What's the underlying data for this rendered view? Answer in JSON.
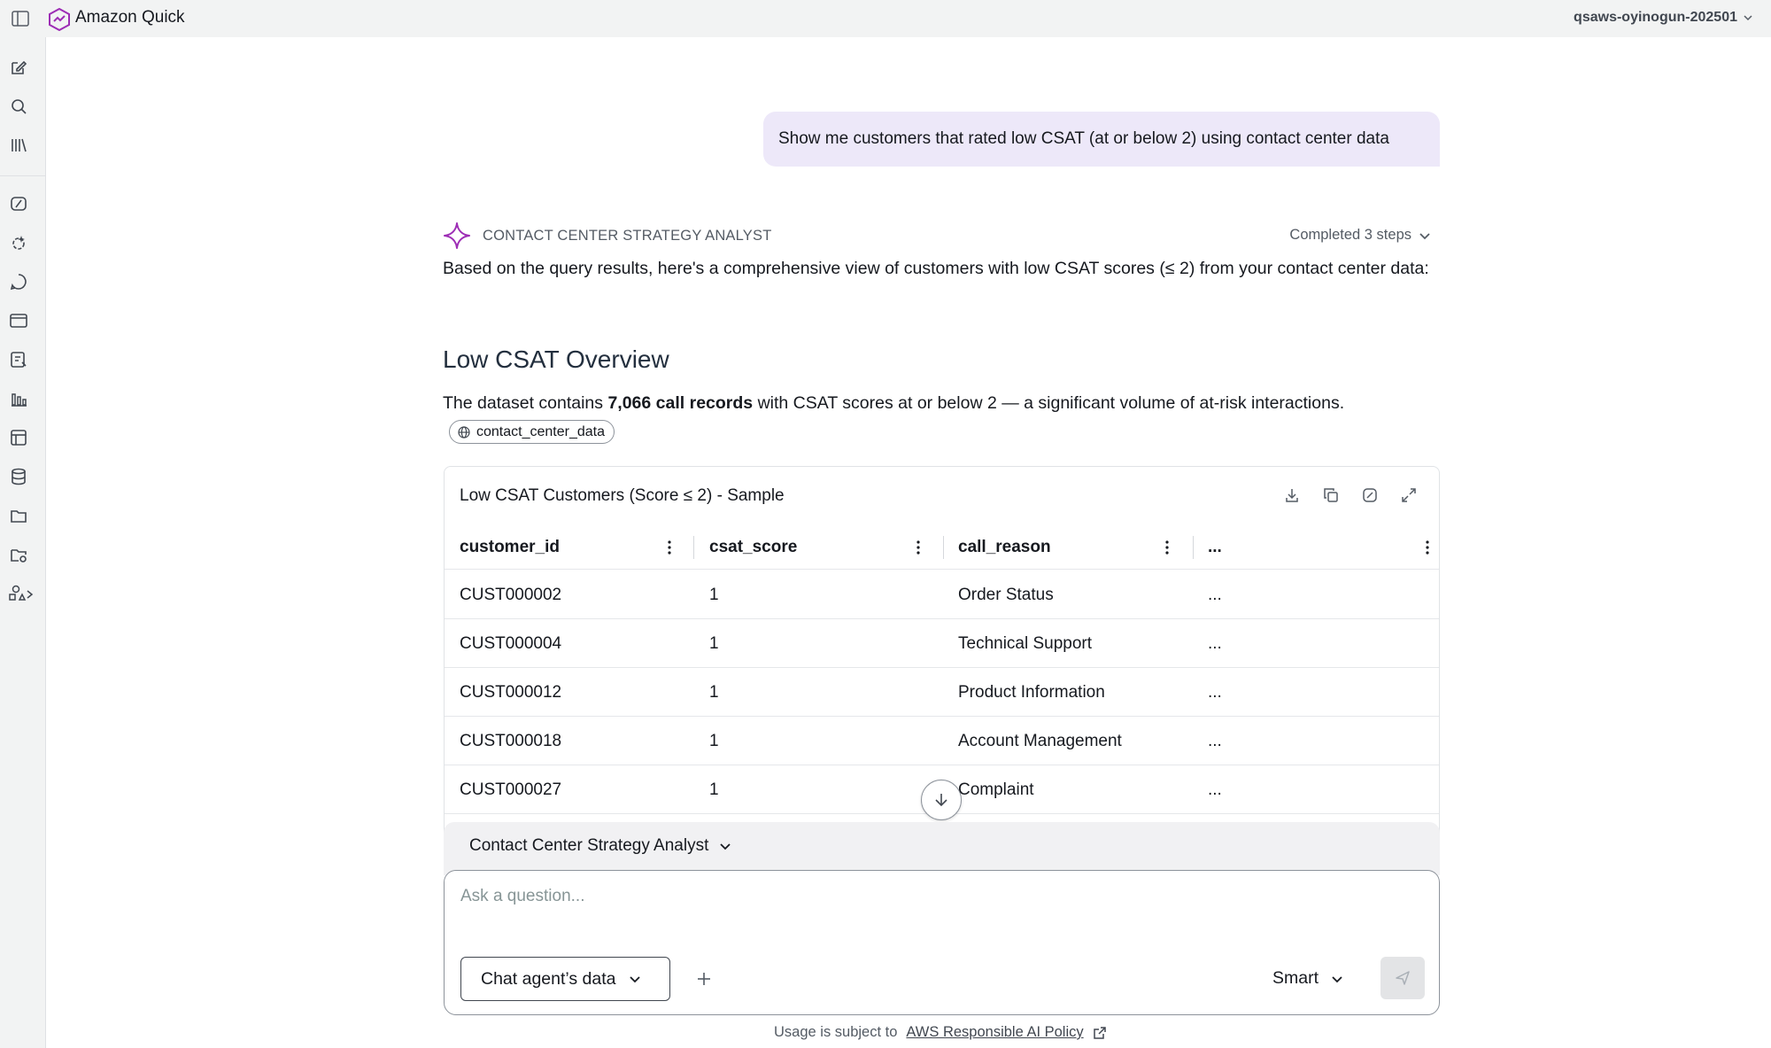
{
  "app": {
    "title": "Amazon Quick",
    "account": "qsaws-oyinogun-202501"
  },
  "rail": {
    "icons": [
      "compose-icon",
      "search-icon",
      "library-icon",
      "agents-icon",
      "research-icon",
      "chat-icon",
      "spaces-icon",
      "flows-icon",
      "dashboards-icon",
      "scenarios-icon",
      "datasets-icon",
      "folders-icon",
      "integrations-icon",
      "extensions-icon"
    ]
  },
  "chat": {
    "user_message": "Show me customers that rated low CSAT (at or below 2) using contact center data",
    "agent_name": "CONTACT CENTER STRATEGY ANALYST",
    "steps_label": "Completed 3 steps",
    "intro": "Based on the query results, here's a comprehensive view of customers with low CSAT scores (≤ 2) from your contact center data:",
    "section_title": "Low CSAT Overview",
    "summary_pre": "The dataset contains ",
    "summary_bold": "7,066 call records",
    "summary_post": " with CSAT scores at or below 2 — a significant volume of at-risk interactions.",
    "source_chip": "contact_center_data"
  },
  "table": {
    "title": "Low CSAT Customers (Score ≤ 2) - Sample",
    "columns": [
      "customer_id",
      "csat_score",
      "call_reason",
      "..."
    ],
    "rows": [
      [
        "CUST000002",
        "1",
        "Order Status",
        "..."
      ],
      [
        "CUST000004",
        "1",
        "Technical Support",
        "..."
      ],
      [
        "CUST000012",
        "1",
        "Product Information",
        "..."
      ],
      [
        "CUST000018",
        "1",
        "Account Management",
        "..."
      ],
      [
        "CUST000027",
        "1",
        "Complaint",
        "..."
      ]
    ]
  },
  "composer": {
    "agent_selector": "Contact Center Strategy Analyst",
    "placeholder": "Ask a question...",
    "data_button": "Chat agent’s data",
    "mode": "Smart"
  },
  "footer": {
    "text": "Usage is subject to",
    "link": "AWS Responsible AI Policy"
  },
  "colors": {
    "accent": "#9d2db5",
    "user_bubble": "#ede8f9",
    "rail_bg": "#f2f3f3",
    "send_disabled": "#e3e4e6"
  }
}
